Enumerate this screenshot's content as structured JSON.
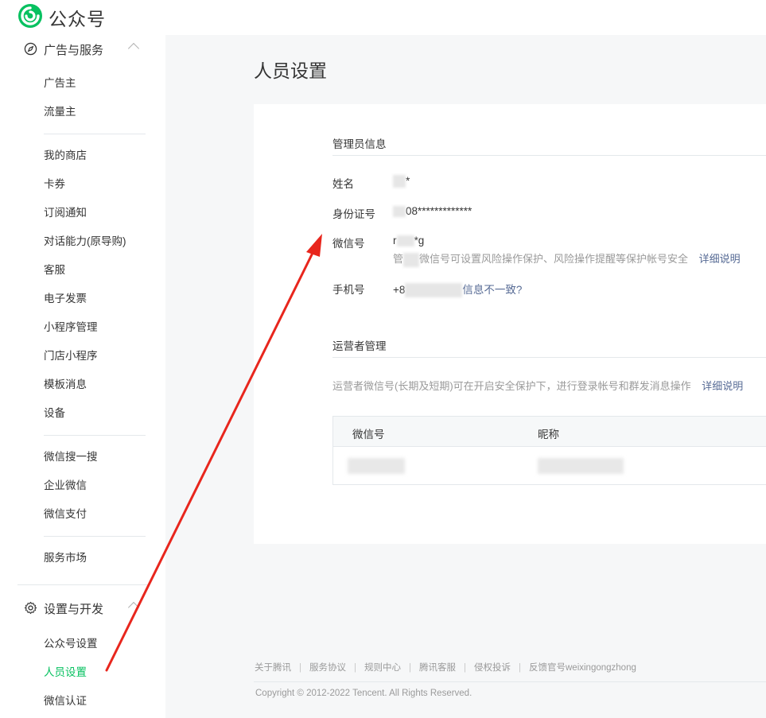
{
  "app": {
    "brand": "公众号",
    "brand_color": "#07c160"
  },
  "sidebar": {
    "group1": {
      "label": "广告与服务",
      "icon": "compass-icon"
    },
    "group1_items": [
      "广告主",
      "流量主"
    ],
    "group2_items": [
      "我的商店",
      "卡券",
      "订阅通知",
      "对话能力(原导购)",
      "客服",
      "电子发票",
      "小程序管理",
      "门店小程序",
      "模板消息",
      "设备"
    ],
    "group3_items": [
      "微信搜一搜",
      "企业微信",
      "微信支付"
    ],
    "group4_items": [
      "服务市场"
    ],
    "group5": {
      "label": "设置与开发",
      "icon": "gear-icon"
    },
    "group5_items": [
      "公众号设置",
      "人员设置",
      "微信认证"
    ],
    "active_item": "人员设置"
  },
  "main": {
    "title": "人员设置",
    "admin_section": {
      "title": "管理员信息",
      "name_label": "姓名",
      "name_value": "*",
      "id_label": "身份证号",
      "id_value": "08*************",
      "wechat_label": "微信号",
      "wechat_value_prefix": "r",
      "wechat_value_suffix": "*g",
      "wechat_hint_prefix": "管",
      "wechat_hint": "微信号可设置风险操作保护、风险操作提醒等保护帐号安全",
      "wechat_hint_link": "详细说明",
      "phone_label": "手机号",
      "phone_value": "+8",
      "phone_link": "信息不一致?"
    },
    "operator_section": {
      "title": "运营者管理",
      "hint": "运营者微信号(长期及短期)可在开启安全保护下，进行登录帐号和群发消息操作",
      "hint_link": "详细说明",
      "columns": [
        "微信号",
        "昵称"
      ]
    }
  },
  "footer": {
    "links": [
      "关于腾讯",
      "服务协议",
      "规则中心",
      "腾讯客服",
      "侵权投诉",
      "反馈官号weixingongzhong"
    ],
    "separator": "|",
    "copyright": "Copyright © 2012-2022 Tencent. All Rights Reserved."
  },
  "annotation": {
    "arrow_color": "#e8261d"
  }
}
